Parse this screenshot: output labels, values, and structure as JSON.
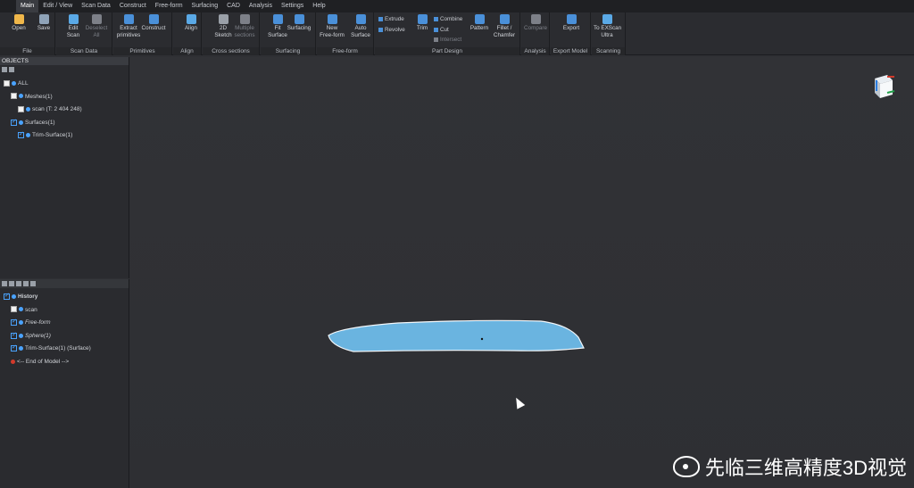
{
  "menu": {
    "items": [
      "Main",
      "Edit / View",
      "Scan Data",
      "Construct",
      "Free-form",
      "Surfacing",
      "CAD",
      "Analysis",
      "Settings",
      "Help"
    ],
    "active_index": 0
  },
  "ribbon": {
    "groups": [
      {
        "label": "File",
        "buttons": [
          {
            "l1": "Open",
            "l2": "",
            "icon": "folder-icon",
            "color": "#f0b74a"
          },
          {
            "l1": "Save",
            "l2": "",
            "icon": "save-icon",
            "color": "#8fa3b8"
          }
        ]
      },
      {
        "label": "Scan Data",
        "buttons": [
          {
            "l1": "Edit",
            "l2": "Scan",
            "icon": "edit-scan-icon",
            "color": "#5aa9e6"
          },
          {
            "l1": "Deselect",
            "l2": "All",
            "icon": "deselect-icon",
            "color": "#7d8088",
            "dim": true
          }
        ]
      },
      {
        "label": "Primitives",
        "buttons": [
          {
            "l1": "Extract",
            "l2": "primitives",
            "icon": "extract-icon",
            "color": "#4a90d9"
          },
          {
            "l1": "Construct",
            "l2": "",
            "icon": "construct-icon",
            "color": "#4a90d9"
          }
        ]
      },
      {
        "label": "Align",
        "buttons": [
          {
            "l1": "Align",
            "l2": "",
            "icon": "align-icon",
            "color": "#5aa9e6"
          }
        ]
      },
      {
        "label": "Cross sections",
        "buttons": [
          {
            "l1": "2D",
            "l2": "Sketch",
            "icon": "sketch-icon",
            "color": "#9aa0a8"
          },
          {
            "l1": "Multiple",
            "l2": "sections",
            "icon": "sections-icon",
            "color": "#7d8088",
            "dim": true
          }
        ]
      },
      {
        "label": "Surfacing",
        "buttons": [
          {
            "l1": "Fit",
            "l2": "Surface",
            "icon": "fit-surface-icon",
            "color": "#4a90d9"
          },
          {
            "l1": "Surfacing",
            "l2": "",
            "icon": "surfacing-icon",
            "color": "#4a90d9"
          }
        ]
      },
      {
        "label": "Free-form",
        "buttons": [
          {
            "l1": "New",
            "l2": "Free-form",
            "icon": "new-freeform-icon",
            "color": "#4a90d9"
          },
          {
            "l1": "Auto",
            "l2": "Surface",
            "icon": "auto-surface-icon",
            "color": "#4a90d9"
          }
        ]
      },
      {
        "label": "Part Design",
        "buttons": [
          {
            "l1": "Trim",
            "l2": "",
            "icon": "trim-icon",
            "color": "#4a90d9"
          },
          {
            "l1": "Pattern",
            "l2": "",
            "icon": "pattern-icon",
            "color": "#4a90d9"
          },
          {
            "l1": "Fillet /",
            "l2": "Chamfer",
            "icon": "fillet-icon",
            "color": "#4a90d9"
          }
        ],
        "small": [
          {
            "label": "Extrude",
            "color": "#4a90d9"
          },
          {
            "label": "Revolve",
            "color": "#4a90d9"
          },
          {
            "label": "Combine",
            "color": "#4a90d9"
          },
          {
            "label": "Cut",
            "color": "#4a90d9"
          },
          {
            "label": "Intersect",
            "color": "#7d8088"
          }
        ]
      },
      {
        "label": "Analysis",
        "buttons": [
          {
            "l1": "Compare",
            "l2": "",
            "icon": "compare-icon",
            "color": "#7d8088",
            "dim": true
          }
        ]
      },
      {
        "label": "Export Model",
        "buttons": [
          {
            "l1": "Export",
            "l2": "",
            "icon": "export-icon",
            "color": "#4a90d9"
          }
        ]
      },
      {
        "label": "Scanning",
        "buttons": [
          {
            "l1": "To EXScan",
            "l2": "Ultra",
            "icon": "exscan-icon",
            "color": "#5aa9e6"
          }
        ]
      }
    ]
  },
  "objects": {
    "title": "OBJECTS",
    "items": [
      {
        "label": "ALL",
        "checked": false,
        "indent": 0
      },
      {
        "label": "Meshes(1)",
        "checked": false,
        "indent": 1
      },
      {
        "label": "scan (T: 2 404 248)",
        "checked": false,
        "indent": 2
      },
      {
        "label": "Surfaces(1)",
        "checked": true,
        "indent": 1
      },
      {
        "label": "Trim-Surface(1)",
        "checked": true,
        "indent": 2
      }
    ]
  },
  "history": {
    "items": [
      {
        "label": "History",
        "checked": true,
        "indent": 0,
        "bold": true
      },
      {
        "label": "scan",
        "checked": false,
        "indent": 1
      },
      {
        "label": "Free-form",
        "checked": true,
        "indent": 1,
        "italic": true
      },
      {
        "label": "Sphere(1)",
        "checked": true,
        "indent": 1,
        "italic": true
      },
      {
        "label": "Trim-Surface(1) (Surface)",
        "checked": true,
        "indent": 1
      },
      {
        "label": "<-- End of Model -->",
        "checked": false,
        "indent": 1,
        "marker": true
      }
    ]
  },
  "viewport": {
    "surface_color": "#6ab4e0",
    "background": "#303135"
  },
  "watermark": {
    "text": "先临三维高精度3D视觉"
  }
}
